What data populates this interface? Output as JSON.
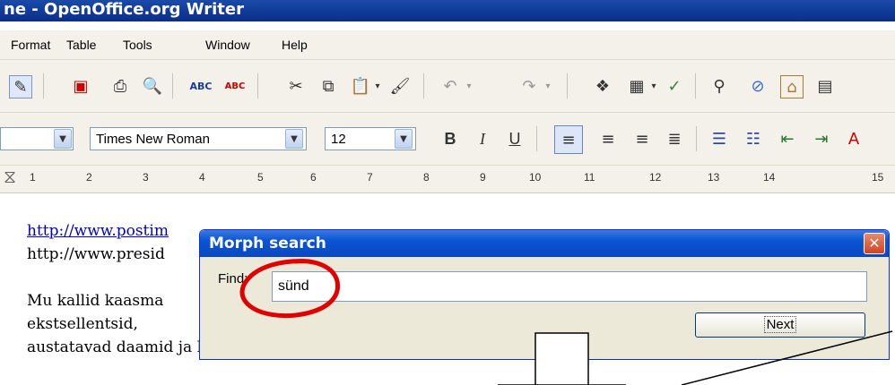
{
  "window": {
    "title": "ne - OpenOffice.org Writer"
  },
  "menu": {
    "items": [
      "Format",
      "Table",
      "Tools",
      "Window",
      "Help"
    ]
  },
  "formatting": {
    "font_name": "Times New Roman",
    "font_size": "12"
  },
  "ruler": {
    "ticks": [
      "1",
      "2",
      "3",
      "4",
      "5",
      "6",
      "7",
      "8",
      "9",
      "10",
      "11",
      "12",
      "13",
      "14",
      "15"
    ]
  },
  "document": {
    "lines": [
      "http://www.postim",
      "http://www.presid",
      "Mu kallid kaasma",
      "ekstsellentsid,",
      "austatavad daamid ja härrad."
    ],
    "link_color": "#0000cc"
  },
  "dialog": {
    "title": "Morph search",
    "find_label": "Find:",
    "find_value": "sünd",
    "next_label": "Next",
    "close_label": "✕"
  },
  "icons": [
    "edit-file-icon",
    "export-pdf-icon",
    "print-icon",
    "page-preview-icon",
    "spellcheck-icon",
    "autospellcheck-icon",
    "cut-icon",
    "copy-icon",
    "paste-icon",
    "format-paintbrush-icon",
    "undo-icon",
    "redo-icon",
    "navigator-icon",
    "table-icon",
    "draw-functions-icon",
    "find-replace-icon",
    "navigator-compass-icon",
    "gallery-icon",
    "datasources-icon"
  ],
  "colors": {
    "annotation": "#e00000",
    "xp_blue": "#0a54d4"
  }
}
